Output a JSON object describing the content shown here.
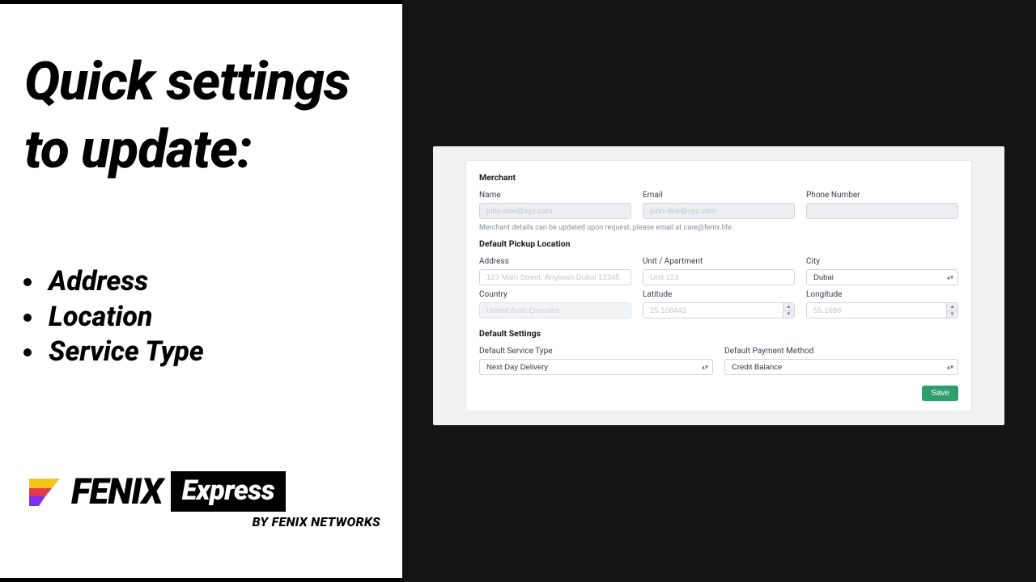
{
  "slide": {
    "headline": "Quick settings to update:",
    "bullets": [
      "Address",
      "Location",
      "Service Type"
    ]
  },
  "brand": {
    "main": "FENIX",
    "badge": "Express",
    "sub": "BY FENIX NETWORKS"
  },
  "form": {
    "section_merchant": "Merchant",
    "name_label": "Name",
    "name_placeholder": "john-doe@xyz.com",
    "email_label": "Email",
    "email_placeholder": "john-doe@xyz.com",
    "phone_label": "Phone Number",
    "helper": "Merchant details can be updated upon request, please email at care@fenix.life.",
    "section_pickup": "Default Pickup Location",
    "address_label": "Address",
    "address_placeholder": "123 Main Street, Anytown Dubai 12345",
    "unit_label": "Unit / Apartment",
    "unit_placeholder": "Unit 123",
    "city_label": "City",
    "city_value": "Dubai",
    "country_label": "Country",
    "country_value": "United Arab Emirates",
    "lat_label": "Latitude",
    "lat_placeholder": "25.108443",
    "lng_label": "Longitude",
    "lng_placeholder": "55.1686",
    "section_defaults": "Default Settings",
    "service_label": "Default Service Type",
    "service_value": "Next Day Delivery",
    "payment_label": "Default Payment Method",
    "payment_value": "Credit Balance",
    "save": "Save"
  }
}
